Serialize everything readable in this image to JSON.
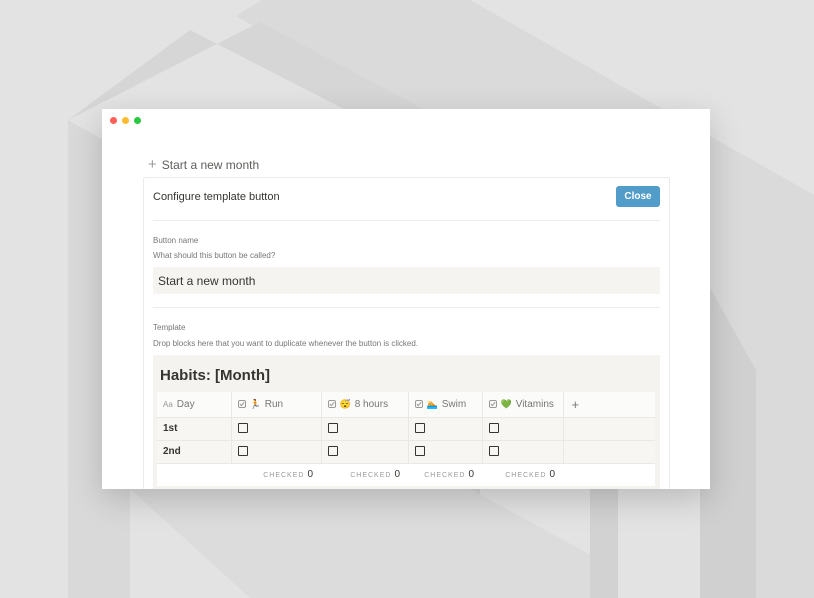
{
  "window": {
    "traffic_lights": {
      "close": "#ff5f57",
      "minimize": "#febc2e",
      "maximize": "#28c840"
    }
  },
  "start_button": {
    "icon": "plus-icon",
    "label": "Start a new month"
  },
  "config": {
    "header": "Configure template button",
    "close_label": "Close",
    "button_name": {
      "label": "Button name",
      "hint": "What should this button be called?",
      "value": "Start a new month"
    },
    "template": {
      "label": "Template",
      "hint": "Drop blocks here that you want to duplicate whenever the button is clicked.",
      "database": {
        "title": "Habits: [Month]",
        "columns": [
          {
            "icon": "text-property-icon",
            "emoji": "",
            "label": "Day"
          },
          {
            "icon": "checkbox-property-icon",
            "emoji": "🏃",
            "label": "Run"
          },
          {
            "icon": "checkbox-property-icon",
            "emoji": "😴",
            "label": "8 hours"
          },
          {
            "icon": "checkbox-property-icon",
            "emoji": "🏊",
            "label": "Swim"
          },
          {
            "icon": "checkbox-property-icon",
            "emoji": "💚",
            "label": "Vitamins"
          }
        ],
        "add_column_icon": "plus-icon",
        "rows": [
          {
            "day": "1st",
            "checks": [
              false,
              false,
              false,
              false
            ]
          },
          {
            "day": "2nd",
            "checks": [
              false,
              false,
              false,
              false
            ]
          }
        ],
        "calculation": {
          "label": "CHECKED",
          "values": [
            "0",
            "0",
            "0",
            "0"
          ]
        }
      }
    }
  },
  "colors": {
    "accent": "#529cca",
    "background": "#e3e3e3"
  }
}
